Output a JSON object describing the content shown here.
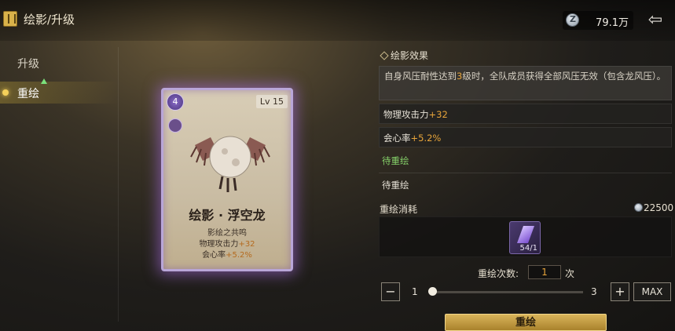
{
  "header": {
    "title": "绘影/升级",
    "currency_value": "79.1万"
  },
  "sidebar": {
    "items": [
      {
        "label": "升级"
      },
      {
        "label": "重绘"
      }
    ]
  },
  "card": {
    "rank": "4",
    "level": "Lv 15",
    "name": "绘影 · 浮空龙",
    "resonance": "影绘之共鸣",
    "stat1_label": "物理攻击力",
    "stat1_value": "+32",
    "stat2_label": "会心率",
    "stat2_value": "+5.2%"
  },
  "effect": {
    "title": "绘影效果",
    "text_before": "自身风压耐性达到",
    "highlight": "3",
    "text_after": "级时，全队成员获得全部风压无效（包含龙风压）。"
  },
  "stats": [
    {
      "label": "物理攻击力",
      "value": "+32"
    },
    {
      "label": "会心率",
      "value": "+5.2%"
    }
  ],
  "pending": [
    {
      "label": "待重绘"
    },
    {
      "label": "待重绘"
    }
  ],
  "cost": {
    "title": "重绘消耗",
    "amount": "22500",
    "item_count": "54/1"
  },
  "redraw": {
    "count_label": "重绘次数:",
    "count_value": "1",
    "count_unit": "次",
    "min": "1",
    "max": "3",
    "max_button": "MAX",
    "minus": "−",
    "plus": "+",
    "button": "重绘",
    "slider_position": 0
  },
  "colors": {
    "accent_gold": "#e7a43a",
    "pending_green": "#86d26a",
    "card_glow": "#aa6ee6"
  }
}
